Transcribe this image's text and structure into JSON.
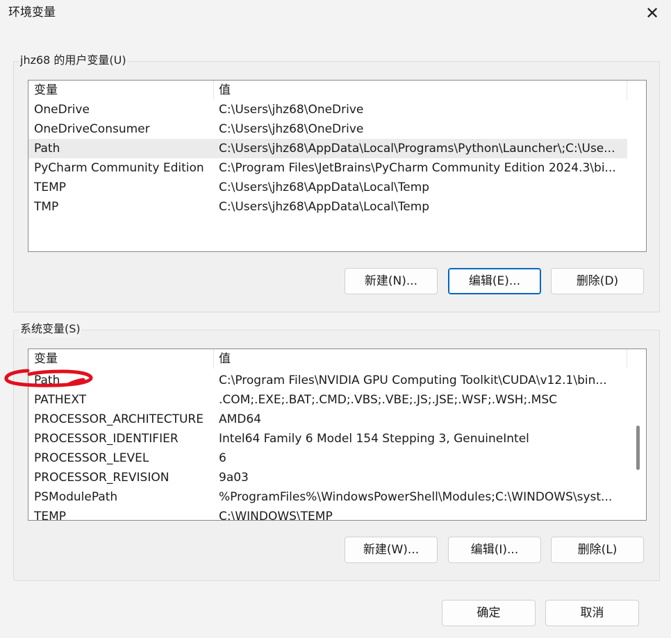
{
  "window": {
    "title": "环境变量",
    "close_glyph": "✕"
  },
  "user_vars": {
    "group_title": "jhz68 的用户变量(U)",
    "header": {
      "name": "变量",
      "value": "值"
    },
    "rows": [
      {
        "name": "OneDrive",
        "value": "C:\\Users\\jhz68\\OneDrive"
      },
      {
        "name": "OneDriveConsumer",
        "value": "C:\\Users\\jhz68\\OneDrive"
      },
      {
        "name": "Path",
        "value": "C:\\Users\\jhz68\\AppData\\Local\\Programs\\Python\\Launcher\\;C:\\Use..."
      },
      {
        "name": "PyCharm Community Edition",
        "value": "C:\\Program Files\\JetBrains\\PyCharm Community Edition 2024.3\\bi..."
      },
      {
        "name": "TEMP",
        "value": "C:\\Users\\jhz68\\AppData\\Local\\Temp"
      },
      {
        "name": "TMP",
        "value": "C:\\Users\\jhz68\\AppData\\Local\\Temp"
      }
    ],
    "selected_row": "Path",
    "buttons": {
      "new": "新建(N)...",
      "edit": "编辑(E)...",
      "delete": "删除(D)"
    }
  },
  "system_vars": {
    "group_title": "系统变量(S)",
    "header": {
      "name": "变量",
      "value": "值"
    },
    "rows": [
      {
        "name": "Path",
        "value": "C:\\Program Files\\NVIDIA GPU Computing Toolkit\\CUDA\\v12.1\\bin..."
      },
      {
        "name": "PATHEXT",
        "value": ".COM;.EXE;.BAT;.CMD;.VBS;.VBE;.JS;.JSE;.WSF;.WSH;.MSC"
      },
      {
        "name": "PROCESSOR_ARCHITECTURE",
        "value": "AMD64"
      },
      {
        "name": "PROCESSOR_IDENTIFIER",
        "value": "Intel64 Family 6 Model 154 Stepping 3, GenuineIntel"
      },
      {
        "name": "PROCESSOR_LEVEL",
        "value": "6"
      },
      {
        "name": "PROCESSOR_REVISION",
        "value": "9a03"
      },
      {
        "name": "PSModulePath",
        "value": "%ProgramFiles%\\WindowsPowerShell\\Modules;C:\\WINDOWS\\syst..."
      },
      {
        "name": "TEMP",
        "value": "C:\\WINDOWS\\TEMP"
      }
    ],
    "buttons": {
      "new": "新建(W)...",
      "edit": "编辑(I)...",
      "delete": "删除(L)"
    },
    "annotation_color": "#e0101e"
  },
  "footer": {
    "ok": "确定",
    "cancel": "取消"
  },
  "colors": {
    "focus_border": "#0067c0",
    "selected_row": "#ebebeb"
  }
}
